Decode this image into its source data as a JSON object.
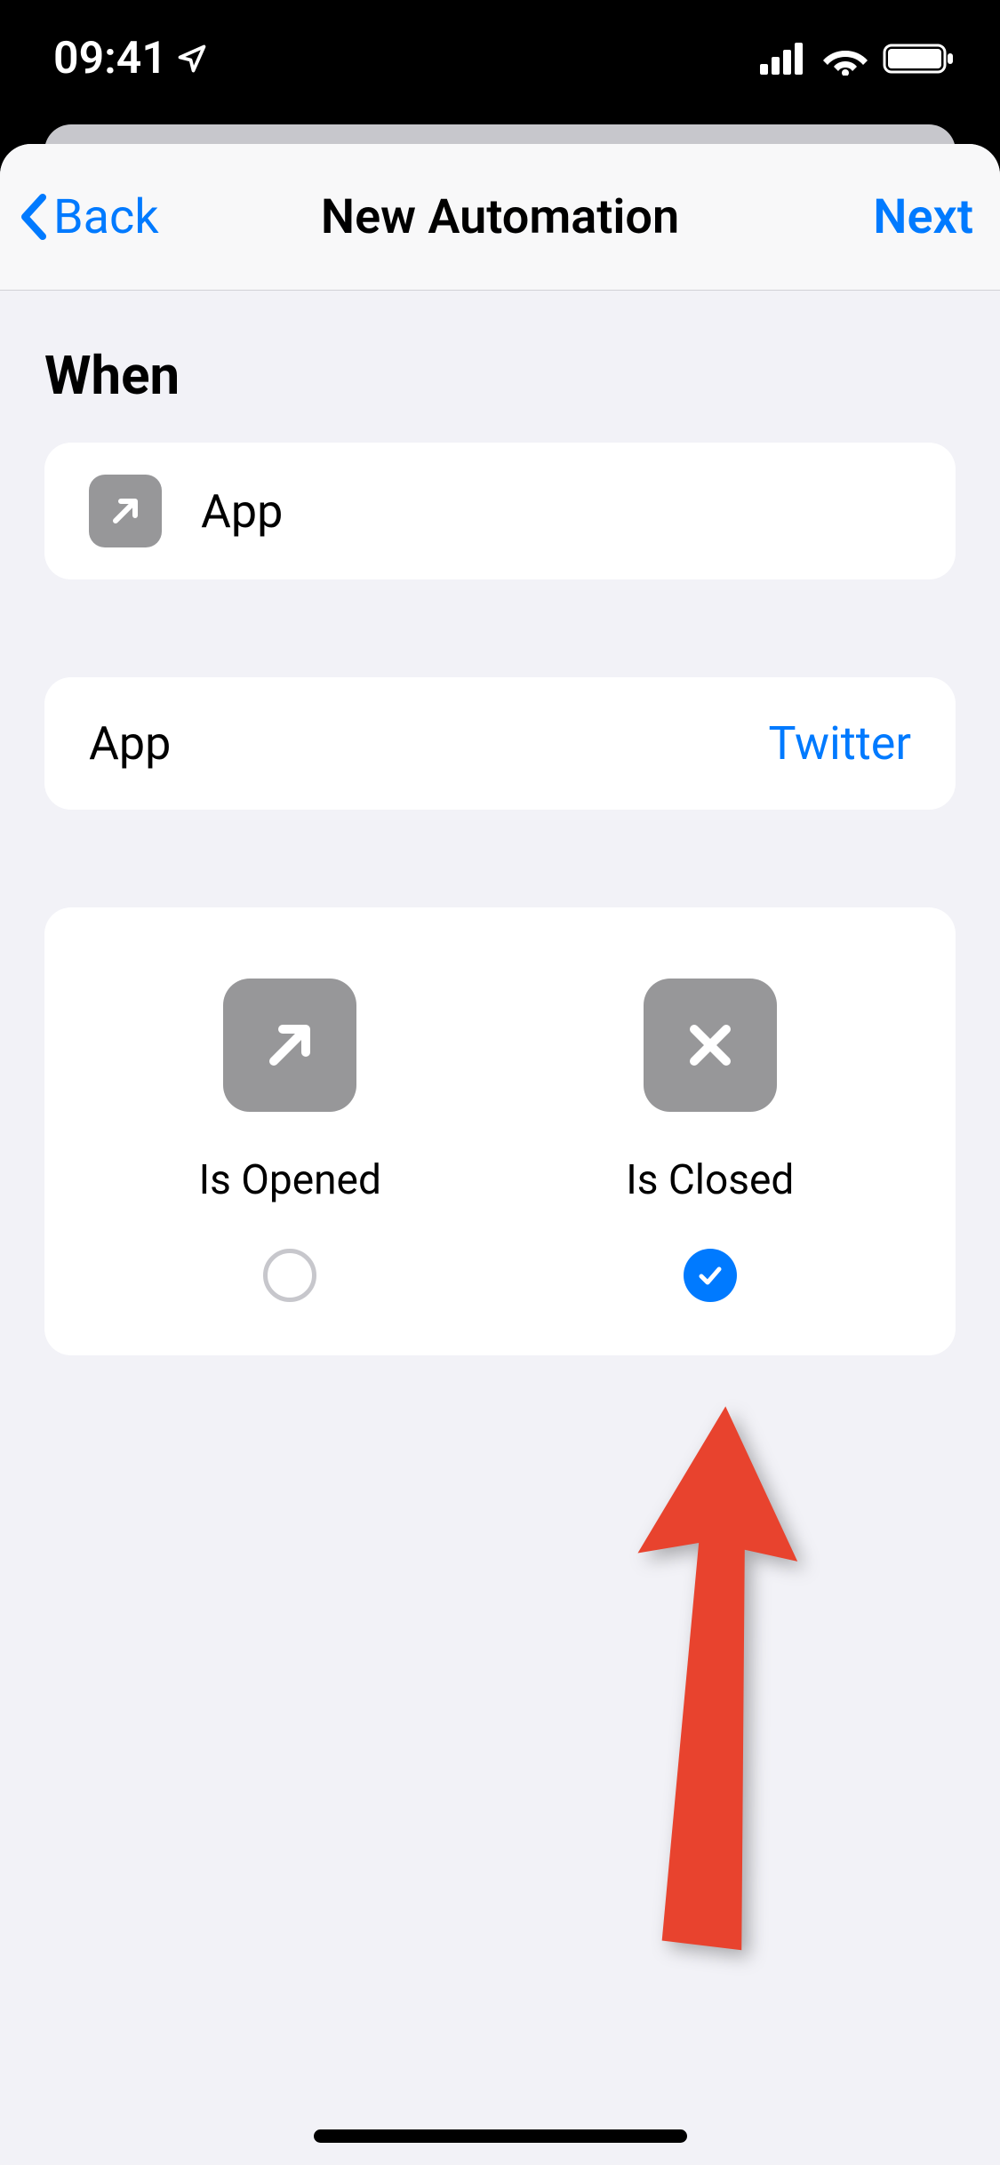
{
  "status": {
    "time": "09:41"
  },
  "nav": {
    "back": "Back",
    "title": "New Automation",
    "next": "Next"
  },
  "section": {
    "heading": "When"
  },
  "trigger": {
    "label": "App"
  },
  "app_selector": {
    "label": "App",
    "value": "Twitter"
  },
  "options": {
    "opened": {
      "label": "Is Opened",
      "checked": false
    },
    "closed": {
      "label": "Is Closed",
      "checked": true
    }
  }
}
